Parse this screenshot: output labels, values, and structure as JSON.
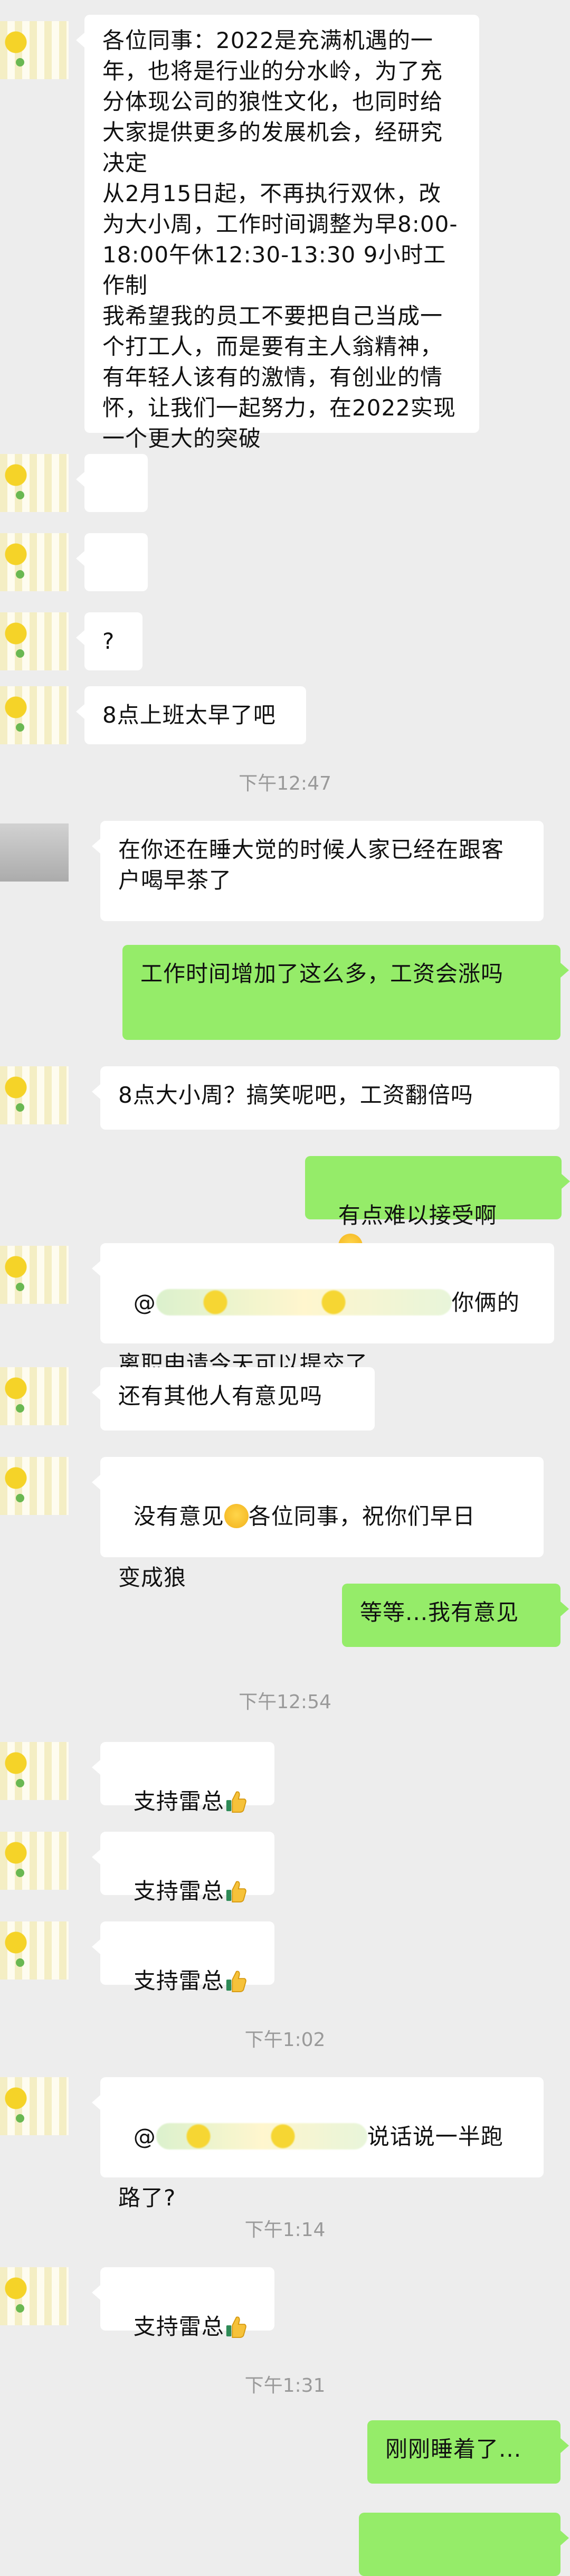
{
  "messages": {
    "m1": "各位同事：2022是充满机遇的一年，也将是行业的分水岭，为了充分体现公司的狼性文化，也同时给大家提供更多的发展机会，经研究决定\n从2月15日起，不再执行双休，改为大小周，工作时间调整为早8:00-18:00午休12:30-13:30 9小时工作制\n我希望我的员工不要把自己当成一个打工人，而是要有主人翁精神，有年轻人该有的激情，有创业的情怀，让我们一起努力，在2022实现一个更大的突破",
    "m4": "?",
    "m5": "8点上班太早了吧",
    "m6": "在你还在睡大觉的时候人家已经在跟客户喝早茶了",
    "m7": "工作时间增加了这么多，工资会涨吗",
    "m8": "8点大小周？搞笑呢吧，工资翻倍吗",
    "m9": "有点难以接受啊",
    "m10_prefix": "@",
    "m10_suffix": "你俩的",
    "m10_line2": "离职申请今天可以提交了",
    "m11": "还有其他人有意见吗",
    "m12_a": "没有意见",
    "m12_b": "各位同事，祝你们早日",
    "m12_c": "变成狼",
    "m13": "等等...我有意见",
    "m14": "支持雷总",
    "m15": "支持雷总",
    "m16": "支持雷总",
    "m17_prefix": "@",
    "m17_suffix": "说话说一半跑",
    "m17_line2": "路了?",
    "m18": "支持雷总",
    "m19": "刚刚睡着了..."
  },
  "timestamps": {
    "t1": "下午12:47",
    "t2": "下午12:54",
    "t3": "下午1:02",
    "t4": "下午1:14",
    "t5": "下午1:31"
  },
  "colors": {
    "incoming": "#ffffff",
    "outgoing": "#95ec69",
    "background": "#ededed",
    "timestamp": "#9a9a9a"
  },
  "icons": {
    "thumbs_up": "thumbs-up-emoji",
    "smile": "smile-emoji",
    "sweat": "sweat-smile-emoji"
  }
}
